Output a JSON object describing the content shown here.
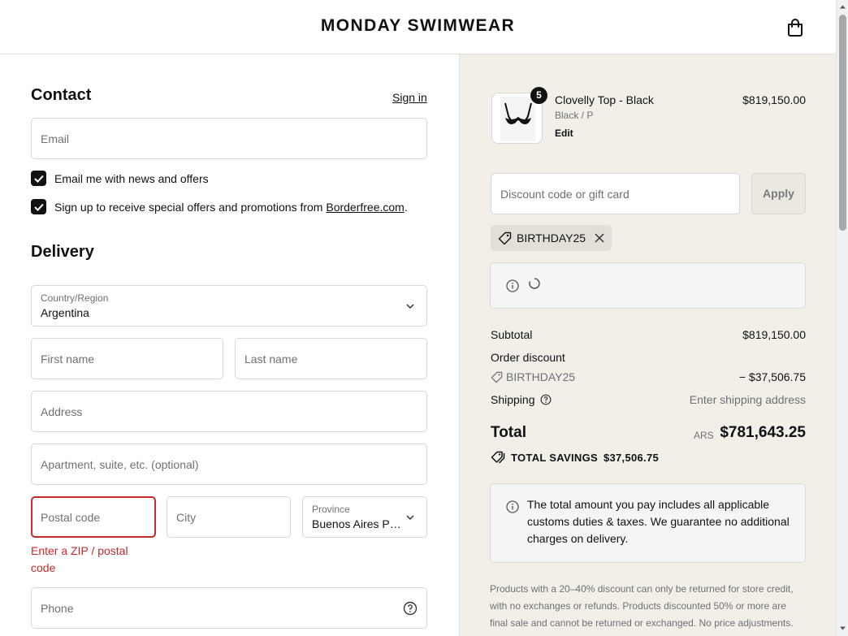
{
  "header": {
    "brand": "MONDAY SWIMWEAR"
  },
  "contact": {
    "heading": "Contact",
    "sign_in": "Sign in",
    "email_placeholder": "Email",
    "news_checkbox_label": "Email me with news and offers",
    "news_checked": true,
    "borderfree_text": "Sign up to receive special offers and promotions from ",
    "borderfree_link": "Borderfree.com",
    "borderfree_suffix": ".",
    "borderfree_checked": true
  },
  "delivery": {
    "heading": "Delivery",
    "country_label": "Country/Region",
    "country_value": "Argentina",
    "first_name_placeholder": "First name",
    "last_name_placeholder": "Last name",
    "address_placeholder": "Address",
    "apartment_placeholder": "Apartment, suite, etc. (optional)",
    "postal_placeholder": "Postal code",
    "postal_error": "Enter a ZIP / postal code",
    "city_placeholder": "City",
    "province_label": "Province",
    "province_value": "Buenos Aires P…",
    "phone_placeholder": "Phone"
  },
  "summary": {
    "item": {
      "quantity": "5",
      "name": "Clovelly Top - Black",
      "variant": "Black / P",
      "edit": "Edit",
      "price": "$819,150.00"
    },
    "discount_placeholder": "Discount code or gift card",
    "apply_label": "Apply",
    "applied_code": "BIRTHDAY25",
    "subtotal_label": "Subtotal",
    "subtotal_value": "$819,150.00",
    "order_discount_label": "Order discount",
    "discount_code": "BIRTHDAY25",
    "discount_value": "− $37,506.75",
    "shipping_label": "Shipping",
    "shipping_value": "Enter shipping address",
    "total_label": "Total",
    "currency": "ARS",
    "total_value": "$781,643.25",
    "savings_label": "TOTAL SAVINGS",
    "savings_value": "$37,506.75",
    "duties_notice": "The total amount you pay includes all applicable customs duties & taxes. We guarantee no additional charges on delivery.",
    "return_policy": "Products with a 20–40% discount can only be returned for store credit, with no exchanges or refunds. Products discounted 50% or more are final sale and cannot be returned or exchanged. No price adjustments."
  },
  "colors": {
    "error": "#c62a2a",
    "summary_bg": "#f2efe9",
    "checkbox": "#111111"
  }
}
